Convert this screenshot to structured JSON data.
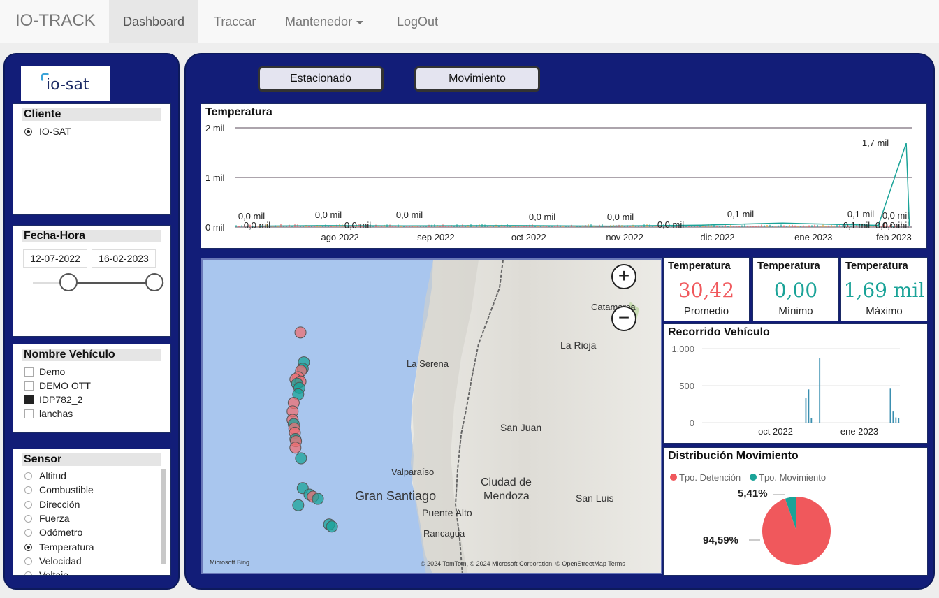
{
  "nav": {
    "brand": "IO-TRACK",
    "items": [
      "Dashboard",
      "Traccar",
      "Mantenedor",
      "LogOut"
    ],
    "active": "Dashboard"
  },
  "logo": {
    "text": "io-sat"
  },
  "cliente": {
    "title": "Cliente",
    "options": [
      {
        "label": "IO-SAT",
        "selected": true
      }
    ]
  },
  "fecha": {
    "title": "Fecha-Hora",
    "start": "12-07-2022",
    "end": "16-02-2023"
  },
  "vehiculo": {
    "title": "Nombre Vehículo",
    "options": [
      {
        "label": "Demo",
        "checked": false
      },
      {
        "label": "DEMO OTT",
        "checked": false
      },
      {
        "label": "IDP782_2",
        "checked": true
      },
      {
        "label": "lanchas",
        "checked": false
      }
    ]
  },
  "sensor": {
    "title": "Sensor",
    "options": [
      {
        "label": "Altitud",
        "selected": false
      },
      {
        "label": "Combustible",
        "selected": false
      },
      {
        "label": "Dirección",
        "selected": false
      },
      {
        "label": "Fuerza",
        "selected": false
      },
      {
        "label": "Odómetro",
        "selected": false
      },
      {
        "label": "Temperatura",
        "selected": true
      },
      {
        "label": "Velocidad",
        "selected": false
      },
      {
        "label": "Voltaje",
        "selected": false
      }
    ]
  },
  "buttons": {
    "estacionado": "Estacionado",
    "movimiento": "Movimiento"
  },
  "colors": {
    "accent": "#1aa398",
    "red": "#f0585c",
    "panel": "#121d78"
  },
  "kpis": [
    {
      "title": "Temperatura",
      "value": "30,42",
      "label": "Promedio",
      "color": "#f0585c"
    },
    {
      "title": "Temperatura",
      "value": "0,00",
      "label": "Mínimo",
      "color": "#1aa398"
    },
    {
      "title": "Temperatura",
      "value": "1,69 mil",
      "label": "Máximo",
      "color": "#1aa398"
    }
  ],
  "map": {
    "attribution": "© 2024 TomTom, © 2024 Microsoft Corporation, © OpenStreetMap  Terms",
    "bing": "Microsoft Bing",
    "zoom_in": "+",
    "zoom_out": "−",
    "labels": [
      "Catamarca",
      "La Rioja",
      "La Serena",
      "San Juan",
      "Valparaíso",
      "Gran Santiago",
      "Ciudad de",
      "Mendoza",
      "San Luis",
      "Puente Alto",
      "Rancagua"
    ],
    "points": [
      {
        "lat": -28.9,
        "lon": -71.46,
        "cat": "red"
      },
      {
        "lat": -29.6,
        "lon": -71.4,
        "cat": "teal"
      },
      {
        "lat": -29.75,
        "lon": -71.42,
        "cat": "teal"
      },
      {
        "lat": -29.8,
        "lon": -71.45,
        "cat": "red"
      },
      {
        "lat": -29.95,
        "lon": -71.5,
        "cat": "red"
      },
      {
        "lat": -30.0,
        "lon": -71.55,
        "cat": "red"
      },
      {
        "lat": -30.05,
        "lon": -71.46,
        "cat": "red"
      },
      {
        "lat": -30.1,
        "lon": -71.52,
        "cat": "teal"
      },
      {
        "lat": -30.2,
        "lon": -71.48,
        "cat": "teal"
      },
      {
        "lat": -30.35,
        "lon": -71.5,
        "cat": "teal"
      },
      {
        "lat": -30.55,
        "lon": -71.58,
        "cat": "red"
      },
      {
        "lat": -30.75,
        "lon": -71.6,
        "cat": "red"
      },
      {
        "lat": -30.95,
        "lon": -71.6,
        "cat": "red"
      },
      {
        "lat": -31.05,
        "lon": -71.58,
        "cat": "teal"
      },
      {
        "lat": -31.15,
        "lon": -71.57,
        "cat": "red"
      },
      {
        "lat": -31.25,
        "lon": -71.56,
        "cat": "red"
      },
      {
        "lat": -31.4,
        "lon": -71.55,
        "cat": "teal"
      },
      {
        "lat": -31.45,
        "lon": -71.54,
        "cat": "red"
      },
      {
        "lat": -31.6,
        "lon": -71.55,
        "cat": "red"
      },
      {
        "lat": -31.85,
        "lon": -71.45,
        "cat": "teal"
      },
      {
        "lat": -32.55,
        "lon": -71.42,
        "cat": "teal"
      },
      {
        "lat": -32.7,
        "lon": -71.3,
        "cat": "teal"
      },
      {
        "lat": -32.75,
        "lon": -71.24,
        "cat": "red"
      },
      {
        "lat": -32.8,
        "lon": -71.15,
        "cat": "teal"
      },
      {
        "lat": -32.95,
        "lon": -71.5,
        "cat": "teal"
      },
      {
        "lat": -33.4,
        "lon": -70.95,
        "cat": "teal"
      },
      {
        "lat": -33.45,
        "lon": -70.9,
        "cat": "teal"
      }
    ]
  },
  "temp_chart": {
    "title": "Temperatura",
    "yticks": [
      "0 mil",
      "1 mil",
      "2 mil"
    ],
    "xticks": [
      "ago 2022",
      "sep 2022",
      "oct 2022",
      "nov 2022",
      "dic 2022",
      "ene 2023",
      "feb 2023"
    ],
    "data_labels": [
      "0,0 mil",
      "0,0 mil",
      "0,0 mil",
      "0,0 mil",
      "0,0 mil",
      "0,0 mil",
      "0,0 mil",
      "0,0 mil",
      "0,1 mil",
      "0,1 mil",
      "0,1 mil",
      "0,0 mil",
      "0,0 mil",
      "0,0 mil",
      "1,7 mil"
    ],
    "peak_label": "1,7 mil"
  },
  "recorrido_chart": {
    "title": "Recorrido Vehículo",
    "yticks": [
      "0",
      "500",
      "1.000"
    ],
    "xticks": [
      "oct 2022",
      "ene 2023"
    ]
  },
  "dist_chart": {
    "title": "Distribución Movimiento",
    "legend": [
      "Tpo. Detención",
      "Tpo. Movimiento"
    ],
    "labels": [
      "94,59%",
      "5,41%"
    ]
  },
  "chart_data": [
    {
      "type": "line",
      "title": "Temperatura",
      "xlabel": "",
      "ylabel": "",
      "ylim": [
        0,
        2000
      ],
      "x": [
        "2022-07-20",
        "2022-08-10",
        "2022-09-05",
        "2022-10-10",
        "2022-11-10",
        "2022-12-10",
        "2023-01-05",
        "2023-02-05",
        "2023-02-14",
        "2023-02-15"
      ],
      "series": [
        {
          "values": [
            20,
            30,
            25,
            30,
            20,
            40,
            80,
            35,
            1690,
            30
          ]
        }
      ],
      "grid": true
    },
    {
      "type": "bar",
      "title": "Recorrido Vehículo",
      "x": [
        "2022-11-05",
        "2022-11-08",
        "2022-11-11",
        "2022-11-20",
        "2023-02-05",
        "2023-02-08",
        "2023-02-11",
        "2023-02-14"
      ],
      "values": [
        330,
        450,
        60,
        870,
        460,
        150,
        70,
        60
      ],
      "ylim": [
        0,
        1000
      ],
      "grid": true
    },
    {
      "type": "pie",
      "title": "Distribución Movimiento",
      "categories": [
        "Tpo. Detención",
        "Tpo. Movimiento"
      ],
      "values": [
        94.59,
        5.41
      ],
      "colors": [
        "#f0585c",
        "#1aa398"
      ],
      "legend": "top-left"
    }
  ]
}
